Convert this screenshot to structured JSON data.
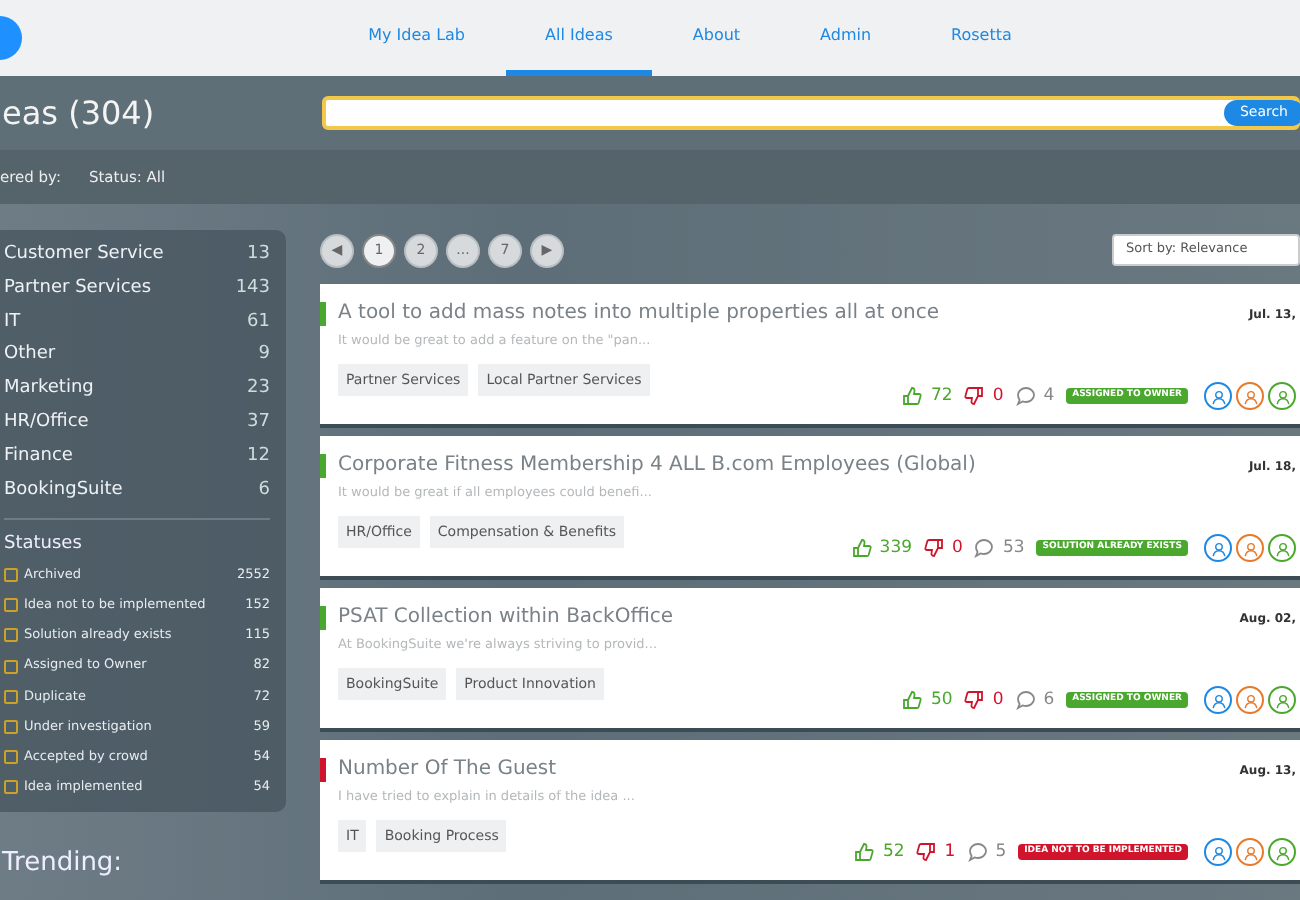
{
  "nav": {
    "tabs": [
      {
        "label": "My Idea Lab",
        "selected": false
      },
      {
        "label": "All Ideas",
        "selected": true
      },
      {
        "label": "About",
        "selected": false
      },
      {
        "label": "Admin",
        "selected": false
      },
      {
        "label": "Rosetta",
        "selected": false
      }
    ]
  },
  "header": {
    "title": "eas (304)",
    "search": {
      "button": "Search"
    }
  },
  "filter_bar": {
    "label": "ered by:",
    "status": "Status: All"
  },
  "sidebar": {
    "categories": [
      {
        "name": "Customer Service",
        "count": "13"
      },
      {
        "name": "Partner Services",
        "count": "143"
      },
      {
        "name": "IT",
        "count": "61"
      },
      {
        "name": "Other",
        "count": "9"
      },
      {
        "name": "Marketing",
        "count": "23"
      },
      {
        "name": "HR/Office",
        "count": "37"
      },
      {
        "name": "Finance",
        "count": "12"
      },
      {
        "name": "BookingSuite",
        "count": "6"
      }
    ],
    "statuses_title": "Statuses",
    "statuses": [
      {
        "name": "Archived",
        "count": "2552",
        "checked": false
      },
      {
        "name": "Idea not to be implemented",
        "count": "152",
        "checked": false
      },
      {
        "name": "Solution already exists",
        "count": "115",
        "checked": false
      },
      {
        "name": "Assigned to Owner",
        "count": "82",
        "checked": false
      },
      {
        "name": "Duplicate",
        "count": "72",
        "checked": false
      },
      {
        "name": "Under investigation",
        "count": "59",
        "checked": false
      },
      {
        "name": "Accepted by crowd",
        "count": "54",
        "checked": false
      },
      {
        "name": "Idea implemented",
        "count": "54",
        "checked": false
      }
    ],
    "trending": "Trending:"
  },
  "pagination": [
    {
      "label": "◀",
      "selected": false
    },
    {
      "label": "1",
      "selected": true
    },
    {
      "label": "2",
      "selected": false
    },
    {
      "label": "...",
      "selected": false
    },
    {
      "label": "7",
      "selected": false
    },
    {
      "label": "▶",
      "selected": false
    }
  ],
  "sort": "Sort by: Relevance",
  "ideas": [
    {
      "title": "A tool to add mass notes into multiple properties all at once",
      "excerpt": "It would be great to add a feature on the \"pan...",
      "date": "Jul. 13,",
      "tags": [
        "Partner Services",
        "Local Partner Services"
      ],
      "likes": "72",
      "dislikes": "0",
      "comments": "4",
      "status": "ASSIGNED TO OWNER",
      "color": "#4aa82e"
    },
    {
      "title": "Corporate Fitness Membership 4 ALL B.com Employees (Global)",
      "excerpt": "It would be great if all employees could benefi...",
      "date": "Jul. 18,",
      "tags": [
        "HR/Office",
        "Compensation & Benefits"
      ],
      "likes": "339",
      "dislikes": "0",
      "comments": "53",
      "status": "SOLUTION ALREADY EXISTS",
      "color": "#4aa82e"
    },
    {
      "title": "PSAT Collection within BackOffice",
      "excerpt": "At BookingSuite we're always striving to provid...",
      "date": "Aug. 02,",
      "tags": [
        "BookingSuite",
        "Product Innovation"
      ],
      "likes": "50",
      "dislikes": "0",
      "comments": "6",
      "status": "ASSIGNED TO OWNER",
      "color": "#4aa82e"
    },
    {
      "title": "Number Of The Guest",
      "excerpt": "I have tried to explain in details of the idea ...",
      "date": "Aug. 13,",
      "tags": [
        "IT",
        "Booking Process"
      ],
      "likes": "52",
      "dislikes": "1",
      "comments": "5",
      "status": "IDEA NOT TO BE IMPLEMENTED",
      "color": "#d0142c"
    }
  ]
}
